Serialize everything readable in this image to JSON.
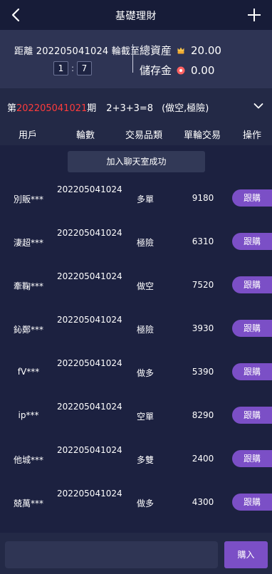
{
  "header": {
    "title": "基礎理財",
    "back_icon": "chevron-left-icon",
    "add_icon": "plus-icon"
  },
  "info": {
    "countdown_text": "距離 202205041024 輪截至",
    "timer": {
      "minutes": "1",
      "separator": ":",
      "seconds": "7"
    },
    "total_assets_label": "總資産",
    "total_assets_value": "20.00",
    "total_assets_icon": "crown-icon",
    "savings_label": "儲存金",
    "savings_value": "0.00",
    "savings_icon": "coin-icon"
  },
  "period": {
    "prefix": "第",
    "number": "202205041021",
    "suffix": "期",
    "rule": "2+3+3=8",
    "result": "(做空,極險)"
  },
  "table": {
    "headers": [
      "用戶",
      "輪數",
      "交易品類",
      "單輪交易",
      "操作"
    ],
    "toast": "加入聊天室成功",
    "rows": [
      {
        "user": "別販***",
        "round": "202205041024",
        "item": "多單",
        "amount": "9180",
        "action": "跟購"
      },
      {
        "user": "淒超***",
        "round": "202205041024",
        "item": "極險",
        "amount": "6310",
        "action": "跟購"
      },
      {
        "user": "牽鞠***",
        "round": "202205041024",
        "item": "做空",
        "amount": "7520",
        "action": "跟購"
      },
      {
        "user": "鈊鄭***",
        "round": "202205041024",
        "item": "極險",
        "amount": "3930",
        "action": "跟購"
      },
      {
        "user": "fV***",
        "round": "202205041024",
        "item": "做多",
        "amount": "5390",
        "action": "跟購"
      },
      {
        "user": "ip***",
        "round": "202205041024",
        "item": "空單",
        "amount": "8290",
        "action": "跟購"
      },
      {
        "user": "他城***",
        "round": "202205041024",
        "item": "多雙",
        "amount": "2400",
        "action": "跟購"
      },
      {
        "user": "兢萬***",
        "round": "202205041024",
        "item": "做多",
        "amount": "4300",
        "action": "跟購"
      }
    ]
  },
  "footer": {
    "input_value": "",
    "buy_label": "購入"
  },
  "colors": {
    "accent": "#7b4fc6",
    "highlight": "#ff3b3b",
    "background": "#232946"
  }
}
